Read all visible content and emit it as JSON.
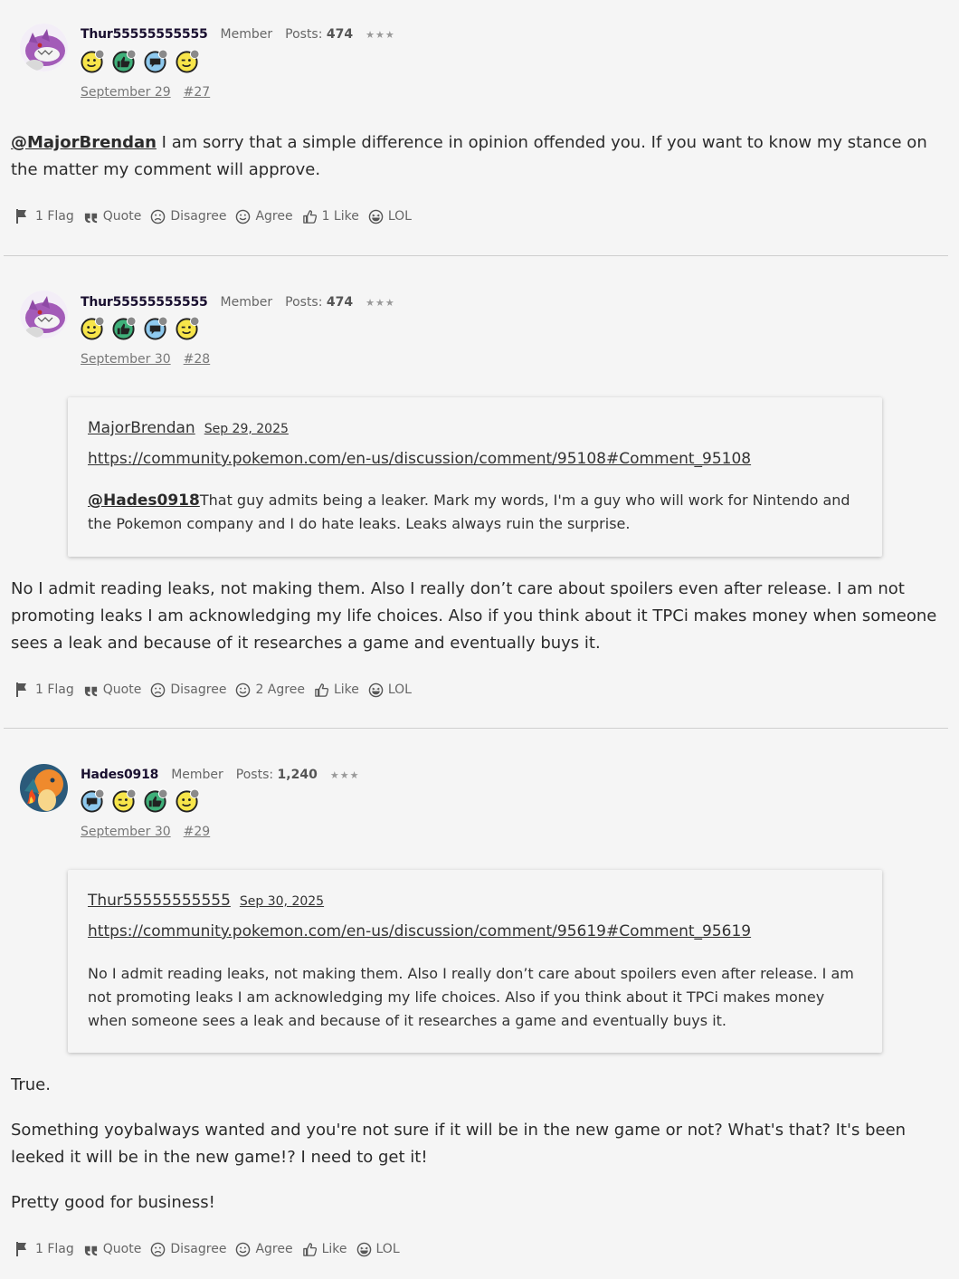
{
  "comments": [
    {
      "author": "Thur55555555555",
      "role": "Member",
      "posts_label": "Posts:",
      "posts_count": "474",
      "rank": "★★★",
      "badges": [
        "smiley-badge",
        "thumbs-badge",
        "comment-badge",
        "wink-badge"
      ],
      "badge_levels": [
        "3",
        "3",
        "3",
        "2"
      ],
      "date": "September 29",
      "number": "#27",
      "mention": "@MajorBrendan",
      "text": " I am sorry that a simple difference in opinion offended you. If you want to know my stance on the matter my comment will approve.",
      "reactions": {
        "flag": "1 Flag",
        "quote": "Quote",
        "disagree": "Disagree",
        "agree": "Agree",
        "like": "1 Like",
        "lol": "LOL"
      }
    },
    {
      "author": "Thur55555555555",
      "role": "Member",
      "posts_label": "Posts:",
      "posts_count": "474",
      "rank": "★★★",
      "badge_levels": [
        "3",
        "3",
        "3",
        "2"
      ],
      "date": "September 30",
      "number": "#28",
      "quote": {
        "author": "MajorBrendan",
        "date": "Sep 29, 2025",
        "link": "https://community.pokemon.com/en-us/discussion/comment/95108#Comment_95108",
        "mention": "@Hades0918",
        "text": "That guy admits being a leaker. Mark my words, I'm a guy who will work for Nintendo and the Pokemon company and I do hate leaks. Leaks always ruin the surprise."
      },
      "text": "No I admit reading leaks, not making them. Also I really don’t care about spoilers even after release. I am not promoting leaks I am acknowledging my life choices. Also if you think about it TPCi makes money when someone sees a leak and because of it researches a game and eventually buys it.",
      "reactions": {
        "flag": "1 Flag",
        "quote": "Quote",
        "disagree": "Disagree",
        "agree": "2 Agree",
        "like": "Like",
        "lol": "LOL"
      }
    },
    {
      "author": "Hades0918",
      "role": "Member",
      "posts_label": "Posts:",
      "posts_count": "1,240",
      "rank": "★★★",
      "badge_levels": [
        "5",
        "5",
        "3",
        "3"
      ],
      "date": "September 30",
      "number": "#29",
      "quote": {
        "author": "Thur55555555555",
        "date": "Sep 30, 2025",
        "link": "https://community.pokemon.com/en-us/discussion/comment/95619#Comment_95619",
        "text": "No I admit reading leaks, not making them. Also I really don’t care about spoilers even after release. I am not promoting leaks I am acknowledging my life choices. Also if you think about it TPCi makes money when someone sees a leak and because of it researches a game and eventually buys it."
      },
      "paragraphs": [
        "True.",
        "Something yoybalways wanted and you're not sure if it will be in the new game or not? What's that? It's been leeked it will be in the new game!? I need to get it!",
        "Pretty good for business!"
      ],
      "reactions": {
        "flag": "1 Flag",
        "quote": "Quote",
        "disagree": "Disagree",
        "agree": "Agree",
        "like": "Like",
        "lol": "LOL"
      }
    }
  ]
}
